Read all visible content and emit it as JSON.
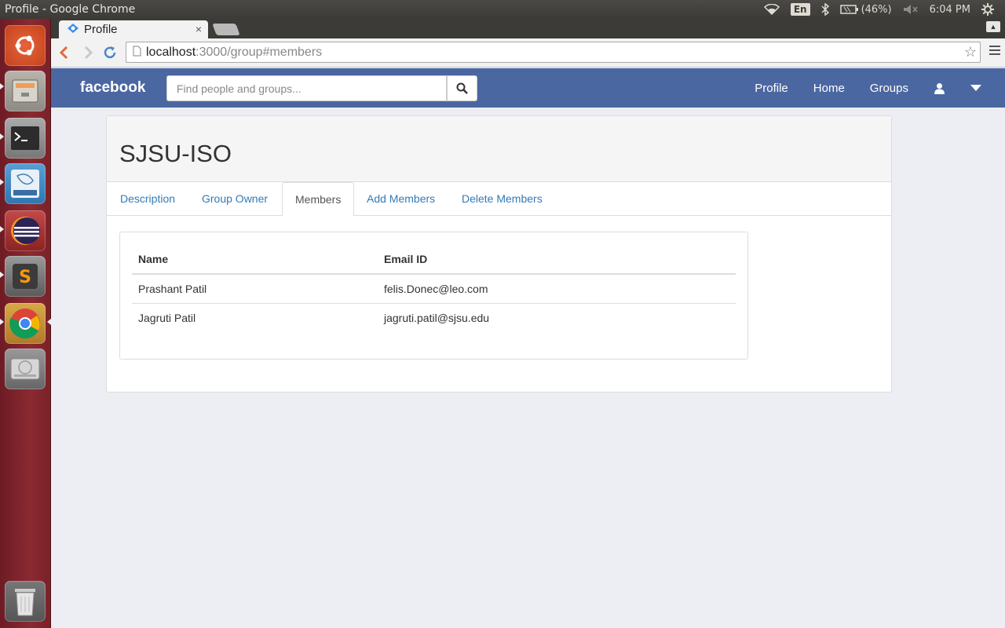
{
  "os": {
    "window_title": "Profile - Google Chrome",
    "lang": "En",
    "battery": "(46%)",
    "clock": "6:04 PM"
  },
  "browser": {
    "tab_title": "Profile",
    "tab_close": "×",
    "url_host": "localhost",
    "url_rest": ":3000/group#members"
  },
  "navbar": {
    "brand": "facebook",
    "search_placeholder": "Find people and groups...",
    "links": [
      "Profile",
      "Home",
      "Groups"
    ]
  },
  "group": {
    "title": "SJSU-ISO",
    "tabs": [
      "Description",
      "Group Owner",
      "Members",
      "Add Members",
      "Delete Members"
    ],
    "active_tab": "Members"
  },
  "members_table": {
    "headers": [
      "Name",
      "Email ID"
    ],
    "rows": [
      [
        "Prashant Patil",
        "felis.Donec@leo.com"
      ],
      [
        "Jagruti Patil",
        "jagruti.patil@sjsu.edu"
      ]
    ]
  },
  "colors": {
    "navbar": "#4b67a1",
    "link": "#337ab7",
    "launcher": "#8a2a31"
  }
}
